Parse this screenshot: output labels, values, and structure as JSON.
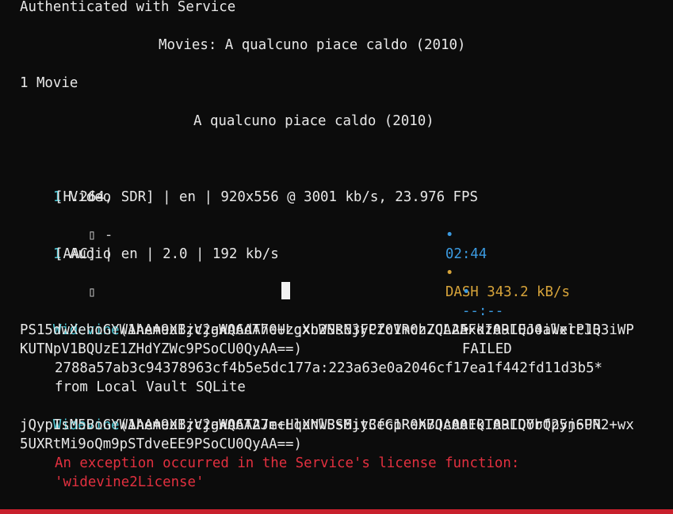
{
  "colors": {
    "background": "#0c0c0c",
    "text": "#d4d4d4",
    "cyan": "#4ec9d6",
    "blue": "#3b9ae0",
    "gold": "#d6a33a",
    "red": "#e2303f",
    "bottom_bar": "#c8202c"
  },
  "auth": "Authenticated with Service",
  "header": "Movies: A qualcuno piace caldo (2010)",
  "movie_count": "1 Movie",
  "movie_title": "A qualcuno piace caldo (2010)",
  "video": {
    "count": "1",
    "label": " Video",
    "details": "[H.264, SDR] | en | 920x556 @ 3001 kb/s, 23.976 FPS",
    "status_icon": "▯",
    "status_dash": " -",
    "bullet1": "•",
    "time": "02:44",
    "bullet2": "•",
    "dash_speed": "DASH 343.2 kB/s"
  },
  "audio": {
    "count": "1",
    "label": " Audio",
    "details": "[AAC] | en | 2.0 | 192 kb/s",
    "status_icon": "▯",
    "bullet1": "•",
    "time": "--:--",
    "bullet2": "•",
    "result": "FAILED"
  },
  "widevine1": {
    "keyword": "Widevine",
    "line1": "(AAAAeXBzc2gAAAAA7e+LqXnWSs6jyCfc1R0h7QAAAFkIARIQJ4ilerPJQ3iWP",
    "line2": "PS15dwXehoGYW1hem9uIjVjaWQ6dTh0Uzgxb2NRN3FPZ0VmczZCL2Exdz09LEo0aWxlclB",
    "line3": "KUTNpV1BQUzE1ZHdYZWc9PSoCU0QyAA==)",
    "key": "2788a57ab3c94378963cf4b5e5dc177a:223a63e0a2046cf17ea1f442fd11d3b5*",
    "source": "from Local Vault SQLite"
  },
  "widevine2": {
    "keyword": "Widevine",
    "line1": "(AAAAeXBzc2gAAAAA7e+LqXnWSs6jyCfc1R0h7QAAAFkIARIQObfpyn6PR2+wx",
    "line2": "jQypIsM5BoGYW1hem9uIjVjaWQ6T2JmcHluNlBSMit3eGpReXBJc001QT09LDYrQ25jSUN",
    "line3": "5UXRtMi9oQm9pSTdveEE9PSoCU0QyAA==)",
    "error1": "An exception occurred in the Service's license function:",
    "error2": "'widevine2License'"
  }
}
